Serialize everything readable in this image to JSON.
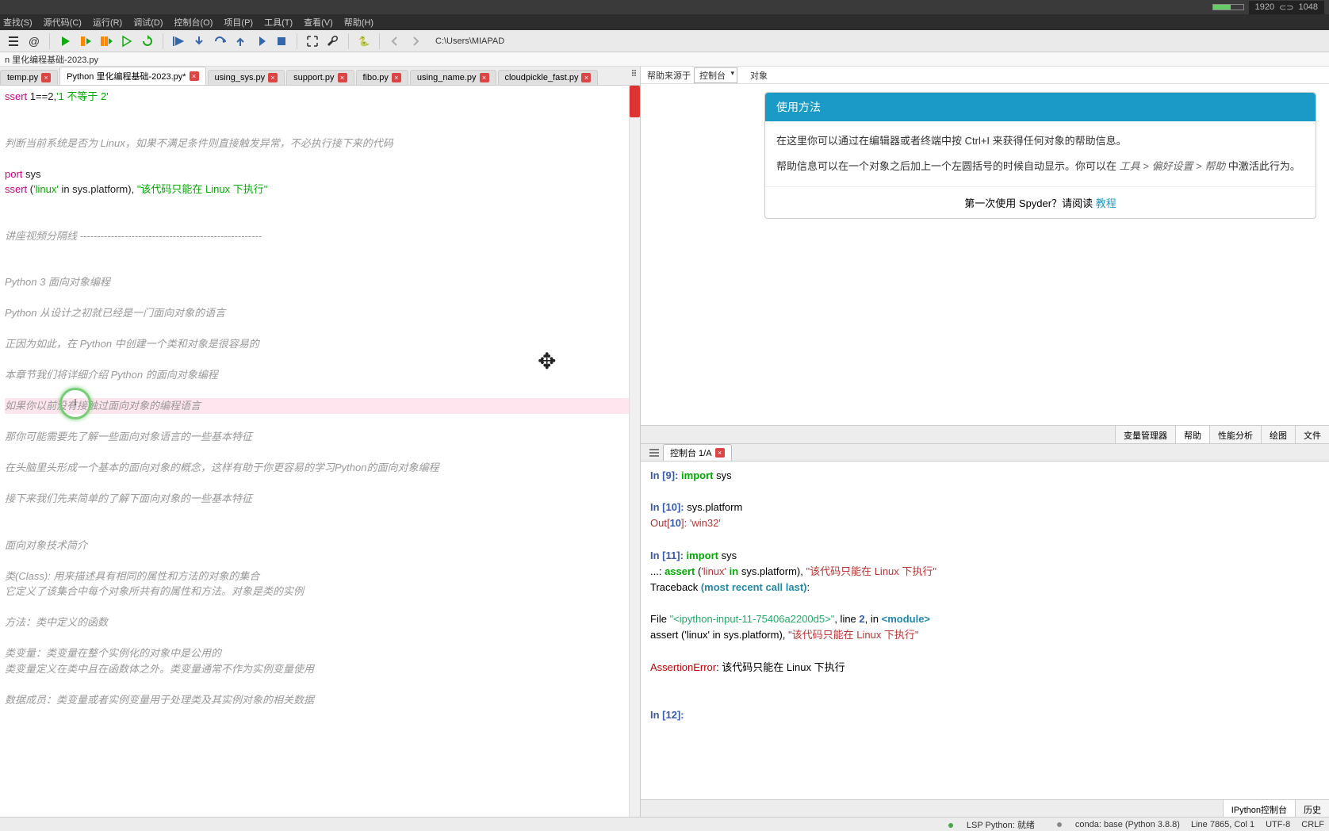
{
  "resolution_badge": {
    "w": "1920",
    "h": "1048",
    "sep": "⊂⊃"
  },
  "menubar": [
    "查找(S)",
    "源代码(C)",
    "运行(R)",
    "调试(D)",
    "控制台(O)",
    "项目(P)",
    "工具(T)",
    "查看(V)",
    "帮助(H)"
  ],
  "path": "C:\\Users\\MIAPAD",
  "breadcrumb": "n 里化编程基础-2023.py",
  "editor_tabs": [
    {
      "label": "temp.py",
      "active": false
    },
    {
      "label": "Python 里化编程基础-2023.py*",
      "active": true
    },
    {
      "label": "using_sys.py",
      "active": false
    },
    {
      "label": "support.py",
      "active": false
    },
    {
      "label": "fibo.py",
      "active": false
    },
    {
      "label": "using_name.py",
      "active": false
    },
    {
      "label": "cloudpickle_fast.py",
      "active": false
    }
  ],
  "editor_lines": [
    {
      "t": "code",
      "text": "ssert 1==2,'1 不等于 2'",
      "parts": [
        {
          "c": "kw",
          "t": "ssert "
        },
        {
          "c": "",
          "t": "1==2,"
        },
        {
          "c": "str",
          "t": "'1 不等于 2'"
        }
      ]
    },
    {
      "t": "blank"
    },
    {
      "t": "blank"
    },
    {
      "t": "comment",
      "text": "判断当前系统是否为 Linux，如果不满足条件则直接触发异常，不必执行接下来的代码"
    },
    {
      "t": "blank"
    },
    {
      "t": "code",
      "parts": [
        {
          "c": "kw",
          "t": "port "
        },
        {
          "c": "",
          "t": "sys"
        }
      ]
    },
    {
      "t": "code",
      "parts": [
        {
          "c": "kw",
          "t": "ssert "
        },
        {
          "c": "",
          "t": "("
        },
        {
          "c": "str",
          "t": "'linux'"
        },
        {
          "c": "",
          "t": " in sys.platform), "
        },
        {
          "c": "str",
          "t": "\"该代码只能在 Linux 下执行\""
        }
      ]
    },
    {
      "t": "blank"
    },
    {
      "t": "blank"
    },
    {
      "t": "comment",
      "text": "讲座视频分隔线 -----------------------------------------------------"
    },
    {
      "t": "blank"
    },
    {
      "t": "blank"
    },
    {
      "t": "comment",
      "text": "Python 3 面向对象编程"
    },
    {
      "t": "blank"
    },
    {
      "t": "comment",
      "text": "Python 从设计之初就已经是一门面向对象的语言"
    },
    {
      "t": "blank"
    },
    {
      "t": "comment",
      "text": "正因为如此，在 Python 中创建一个类和对象是很容易的"
    },
    {
      "t": "blank"
    },
    {
      "t": "comment",
      "text": "本章节我们将详细介绍 Python 的面向对象编程"
    },
    {
      "t": "blank"
    },
    {
      "t": "comment",
      "text": "如果你以前没有接触过面向对象的编程语言",
      "hl": true
    },
    {
      "t": "blank"
    },
    {
      "t": "comment",
      "text": "那你可能需要先了解一些面向对象语言的一些基本特征"
    },
    {
      "t": "blank"
    },
    {
      "t": "comment",
      "text": "在头脑里头形成一个基本的面向对象的概念，这样有助于你更容易的学习Python的面向对象编程"
    },
    {
      "t": "blank"
    },
    {
      "t": "comment",
      "text": "接下来我们先来简单的了解下面向对象的一些基本特征"
    },
    {
      "t": "blank"
    },
    {
      "t": "blank"
    },
    {
      "t": "comment",
      "text": "面向对象技术简介"
    },
    {
      "t": "blank"
    },
    {
      "t": "comment",
      "text": "类(Class): 用来描述具有相同的属性和方法的对象的集合"
    },
    {
      "t": "comment",
      "text": "它定义了该集合中每个对象所共有的属性和方法。对象是类的实例"
    },
    {
      "t": "blank"
    },
    {
      "t": "comment",
      "text": "方法：类中定义的函数"
    },
    {
      "t": "blank"
    },
    {
      "t": "comment",
      "text": "类变量：类变量在整个实例化的对象中是公用的"
    },
    {
      "t": "comment",
      "text": "类变量定义在类中且在函数体之外。类变量通常不作为实例变量使用"
    },
    {
      "t": "blank"
    },
    {
      "t": "comment",
      "text": "数据成员：类变量或者实例变量用于处理类及其实例对象的相关数据"
    }
  ],
  "help": {
    "source_label": "帮助来源于",
    "source_dd": "控制台",
    "object_label": "对象",
    "card_title": "使用方法",
    "body1": "在这里你可以通过在编辑器或者终端中按 Ctrl+I 来获得任何对象的帮助信息。",
    "body2_pre": "帮助信息可以在一个对象之后加上一个左圆括号的时候自动显示。你可以在 ",
    "body2_it": "工具 > 偏好设置 > 帮助",
    "body2_post": " 中激活此行为。",
    "footer_text": "第一次使用 Spyder？请阅读 ",
    "footer_link": "教程"
  },
  "right_tabs": [
    "变量管理器",
    "帮助",
    "性能分析",
    "绘图",
    "文件"
  ],
  "right_tabs_active": 1,
  "console_tab": "控制台 1/A",
  "console_lines": [
    {
      "html": "<span class='pr'>In [</span><span class='num'>9</span><span class='pr'>]:</span> <span class='kwc'>import</span> sys"
    },
    {
      "html": ""
    },
    {
      "html": "<span class='pr'>In [</span><span class='num'>10</span><span class='pr'>]:</span> sys.platform"
    },
    {
      "html": "<span class='val'>Out[</span><span class='num'>10</span><span class='val'>]:</span> <span class='strc'>'win32'</span>"
    },
    {
      "html": ""
    },
    {
      "html": "<span class='pr'>In [</span><span class='num'>11</span><span class='pr'>]:</span> <span class='kwc'>import</span> sys"
    },
    {
      "html": "    ...: <span class='kwc'>assert</span> (<span class='strc'>'linux'</span> <span class='kwc'>in</span> sys.platform), <span class='strc'>\"该代码只能在 Linux 下执行\"</span>"
    },
    {
      "html": "Traceback <span class='kwi'>(most recent call last)</span>:"
    },
    {
      "html": ""
    },
    {
      "html": "  File <span class='file'>\"&lt;ipython-input-11-75406a2200d5&gt;\"</span>, line <span class='num'>2</span>, in <span class='kwi'>&lt;module&gt;</span>"
    },
    {
      "html": "    assert ('linux' in sys.platform), <span class='strc'>\"该代码只能在 Linux 下执行\"</span>"
    },
    {
      "html": ""
    },
    {
      "html": "<span class='err'>AssertionError</span>: 该代码只能在 Linux 下执行"
    },
    {
      "html": ""
    },
    {
      "html": ""
    },
    {
      "html": "<span class='pr'>In [</span><span class='num'>12</span><span class='pr'>]:</span> "
    }
  ],
  "console_footer_tabs": [
    "IPython控制台",
    "历史"
  ],
  "statusbar": {
    "lsp": "LSP Python: 就绪",
    "conda": "conda: base (Python 3.8.8)",
    "pos": "Line 7865, Col 1",
    "enc": "UTF-8",
    "eol": "CRLF"
  }
}
